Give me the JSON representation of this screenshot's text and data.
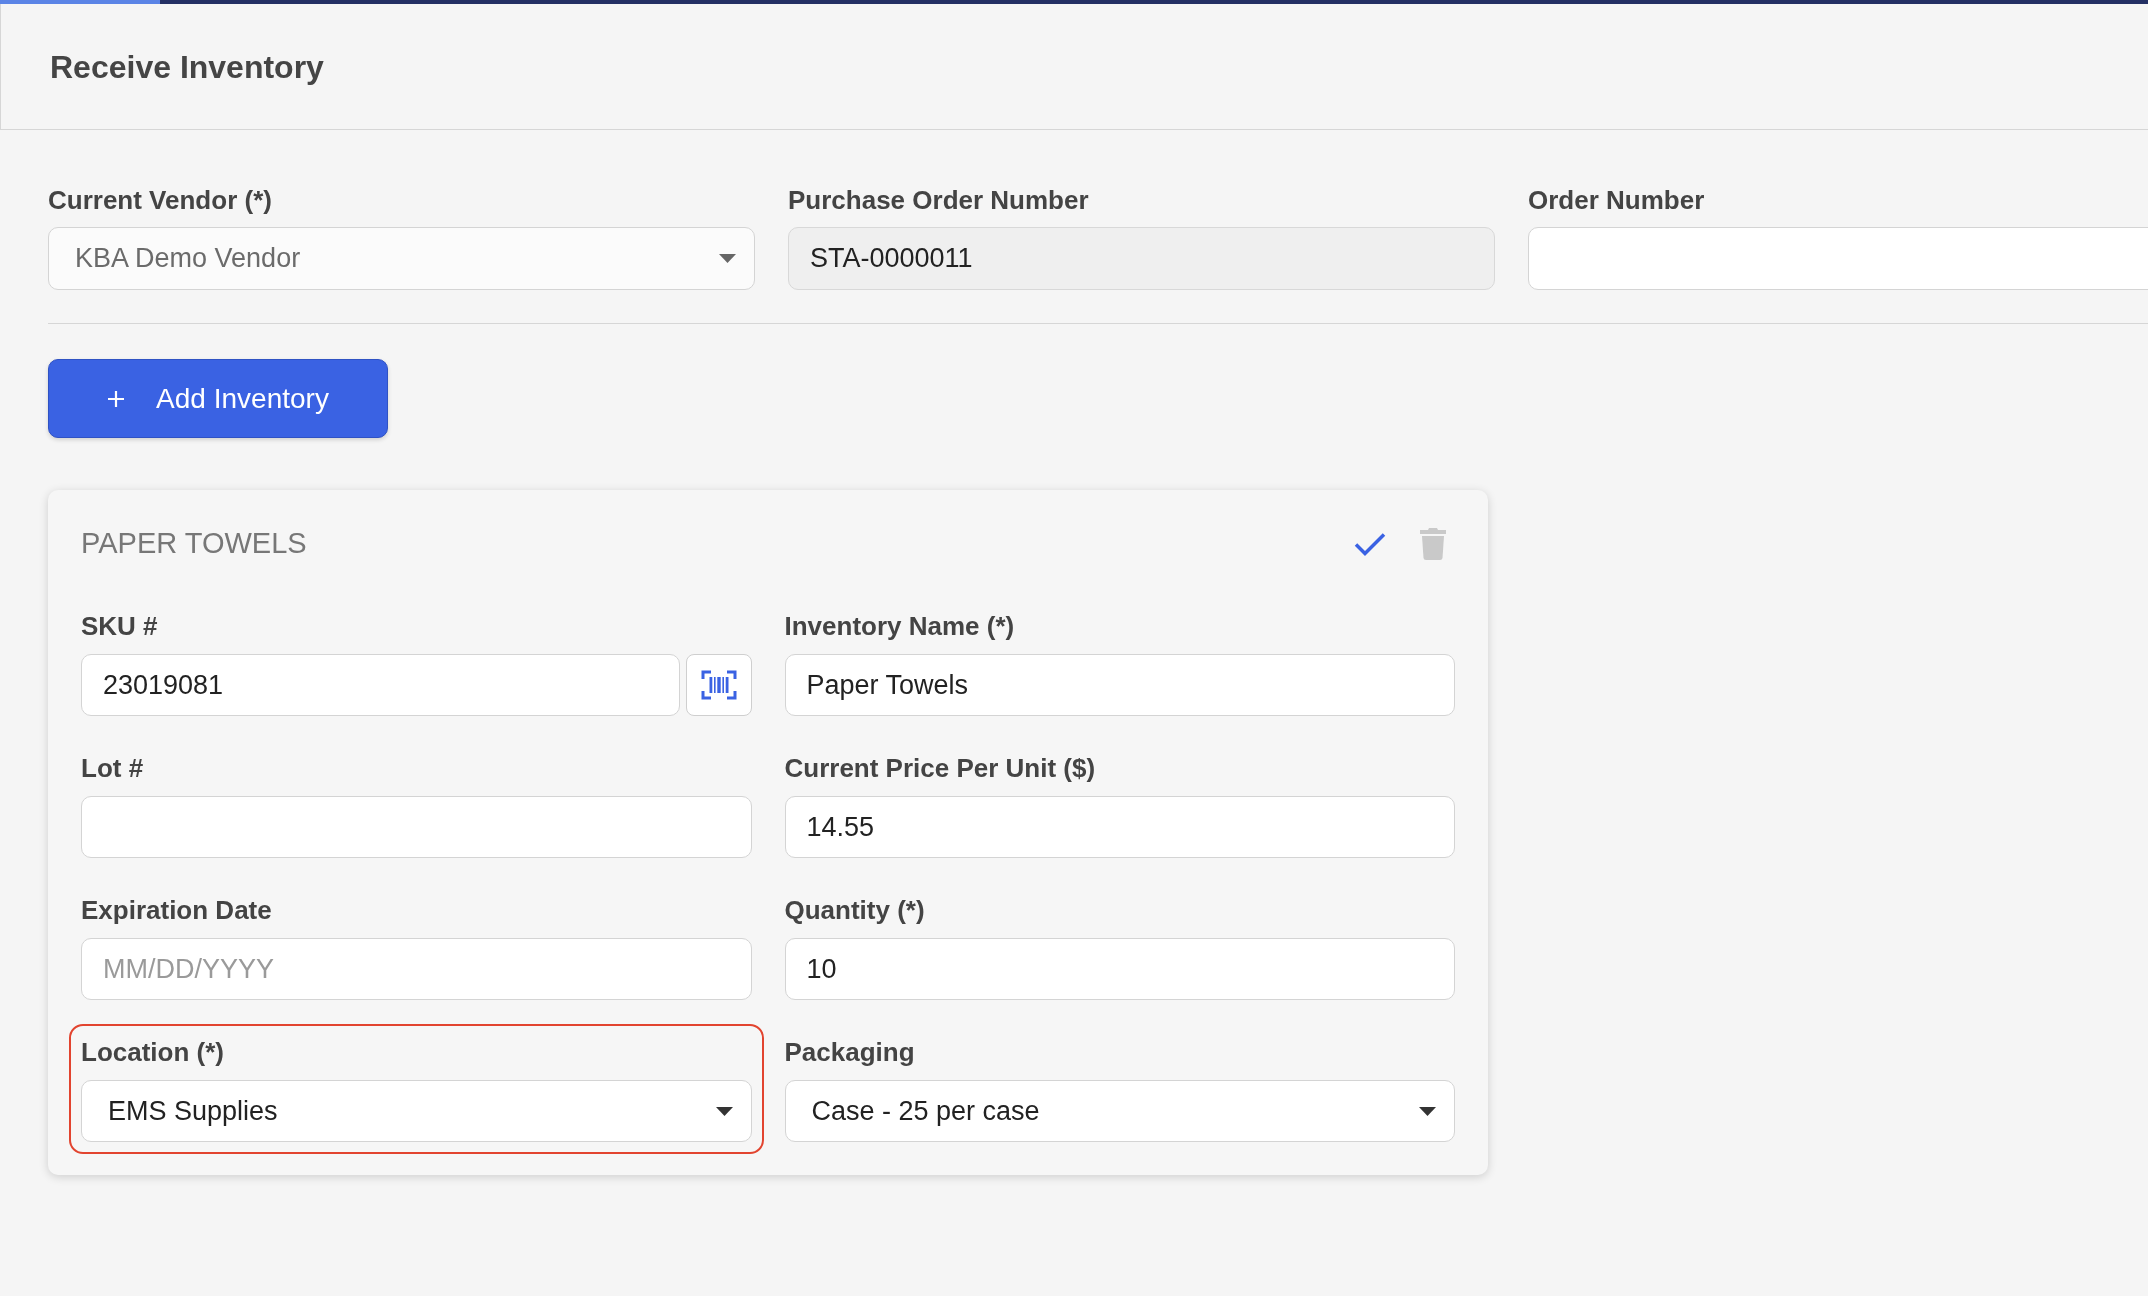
{
  "header": {
    "title": "Receive Inventory"
  },
  "order_fields": [
    {
      "kind": "select",
      "label": "Current Vendor (*)",
      "value": "KBA Demo Vendor",
      "disabled": true
    },
    {
      "kind": "text",
      "label": "Purchase Order Number",
      "value": "STA-0000011",
      "disabled": true
    },
    {
      "kind": "text",
      "label": "Order Number",
      "disabled": false
    }
  ],
  "add_button": {
    "label": "Add Inventory"
  },
  "items": [
    {
      "title": "PAPER TOWELS",
      "fields": [
        {
          "kind": "scan",
          "label": "SKU #",
          "value": "23019081",
          "highlighted": false
        },
        {
          "kind": "text",
          "label": "Inventory Name (*)",
          "value": "Paper Towels",
          "highlighted": false
        },
        {
          "kind": "text",
          "label": "Lot #",
          "highlighted": false
        },
        {
          "kind": "text",
          "label": "Current Price Per Unit ($)",
          "value": "14.55",
          "highlighted": false
        },
        {
          "kind": "text",
          "label": "Expiration Date",
          "placeholder": "MM/DD/YYYY",
          "highlighted": false
        },
        {
          "kind": "text",
          "label": "Quantity (*)",
          "value": "10",
          "highlighted": false
        },
        {
          "kind": "select",
          "label": "Location (*)",
          "value": "EMS Supplies",
          "highlighted": true
        },
        {
          "kind": "select",
          "label": "Packaging",
          "value": "Case - 25 per case",
          "highlighted": false
        }
      ]
    }
  ]
}
